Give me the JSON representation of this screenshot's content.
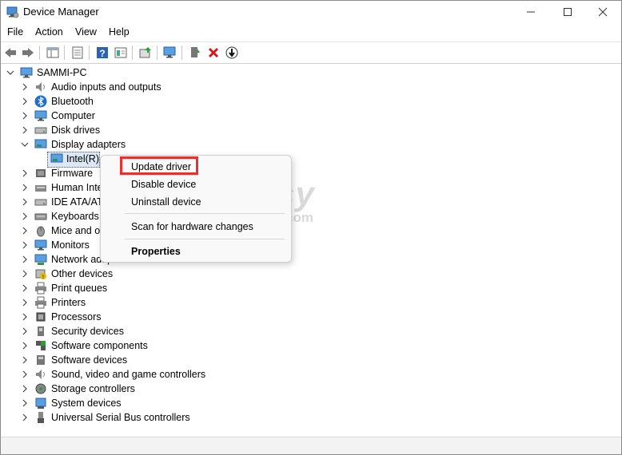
{
  "window": {
    "title": "Device Manager",
    "minimize_icon": "minimize-icon",
    "maximize_icon": "maximize-icon",
    "close_icon": "close-icon"
  },
  "menu": [
    "File",
    "Action",
    "View",
    "Help"
  ],
  "toolbar": {
    "icons": [
      "back-arrow-icon",
      "forward-arrow-icon",
      "show-hide-console-tree-icon",
      "properties-icon",
      "help-icon",
      "view-icon",
      "update-driver-icon",
      "scan-hardware-icon",
      "enable-device-icon",
      "uninstall-icon",
      "disable-device-icon"
    ]
  },
  "tree": {
    "root": "SAMMI-PC",
    "categories": [
      "Audio inputs and outputs",
      "Bluetooth",
      "Computer",
      "Disk drives",
      "Display adapters",
      "Firmware",
      "Human Interface Devices",
      "IDE ATA/ATAPI controllers",
      "Keyboards",
      "Mice and other pointing devices",
      "Monitors",
      "Network adapters",
      "Other devices",
      "Print queues",
      "Printers",
      "Processors",
      "Security devices",
      "Software components",
      "Software devices",
      "Sound, video and game controllers",
      "Storage controllers",
      "System devices",
      "Universal Serial Bus controllers"
    ],
    "visible_labels": {
      "firmware": "Firmware",
      "human_interface": "Human Inte",
      "ide": "IDE ATA/ATA",
      "keyboards": "Keyboards",
      "mice": "Mice and ot",
      "monitors": "Monitors",
      "network": "Network adapters"
    },
    "selected_child": "Intel(R)"
  },
  "context_menu": {
    "items": [
      "Update driver",
      "Disable device",
      "Uninstall device",
      "Scan for hardware changes",
      "Properties"
    ],
    "highlight_color": "#e8302f"
  },
  "watermark": {
    "main": "driver easy",
    "sub": "www.DriverEasy.com"
  },
  "colors": {
    "accent": "#1e6fd0",
    "error_red": "#d11a1a",
    "highlight_red": "#e8302f"
  }
}
